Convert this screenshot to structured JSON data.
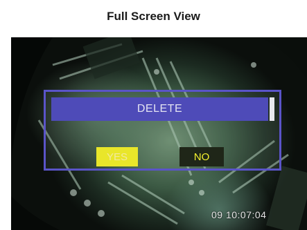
{
  "page": {
    "heading": "Full Screen View"
  },
  "dialog": {
    "title": "DELETE",
    "yes_label": "YES",
    "no_label": "NO",
    "selected": "YES"
  },
  "overlay": {
    "timestamp": "09 10:07:04"
  },
  "colors": {
    "dialog_border": "#5a54c8",
    "dialog_titlebar": "#4e4bb8",
    "yes_highlight": "#e9e62a",
    "no_background": "#1f2618",
    "no_text": "#f4f12e"
  }
}
